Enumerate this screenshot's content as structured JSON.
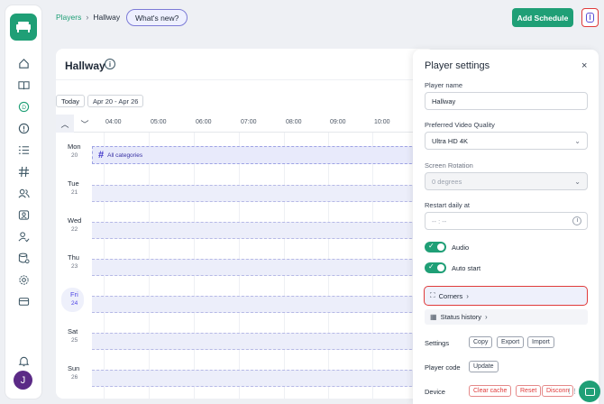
{
  "breadcrumb": {
    "parent": "Players",
    "separator": "›",
    "current": "Hallway"
  },
  "header": {
    "whats_new": "What's new?",
    "add_schedule": "Add Schedule"
  },
  "main": {
    "title": "Hallway",
    "info_glyph": "i",
    "today": "Today",
    "date_range": "Apr 20 - Apr 26",
    "hours": [
      "04:00",
      "05:00",
      "06:00",
      "07:00",
      "08:00",
      "09:00",
      "10:00"
    ],
    "days": [
      {
        "name": "Mon",
        "num": "20"
      },
      {
        "name": "Tue",
        "num": "21"
      },
      {
        "name": "Wed",
        "num": "22"
      },
      {
        "name": "Thu",
        "num": "23"
      },
      {
        "name": "Fri",
        "num": "24"
      },
      {
        "name": "Sat",
        "num": "25"
      },
      {
        "name": "Sun",
        "num": "26"
      }
    ],
    "category_label": "All categories"
  },
  "settings": {
    "title": "Player settings",
    "close": "×",
    "player_name_label": "Player name",
    "player_name_value": "Hallway",
    "video_quality_label": "Preferred Video Quality",
    "video_quality_value": "Ultra HD 4K",
    "rotation_label": "Screen Rotation",
    "rotation_value": "0 degrees",
    "restart_label": "Restart daily at",
    "restart_placeholder": "-- : --",
    "audio_label": "Audio",
    "autostart_label": "Auto start",
    "corners_label": "Corners",
    "status_history_label": "Status history",
    "settings_label": "Settings",
    "copy": "Copy",
    "export": "Export",
    "import": "Import",
    "player_code_label": "Player code",
    "update": "Update",
    "device_label": "Device",
    "clear_cache": "Clear cache",
    "reset": "Reset",
    "disconnect": "Disconn"
  },
  "user": {
    "initial": "J"
  },
  "colors": {
    "brand": "#1f9f76",
    "accent": "#4f46e5",
    "danger": "#e03b3b"
  }
}
